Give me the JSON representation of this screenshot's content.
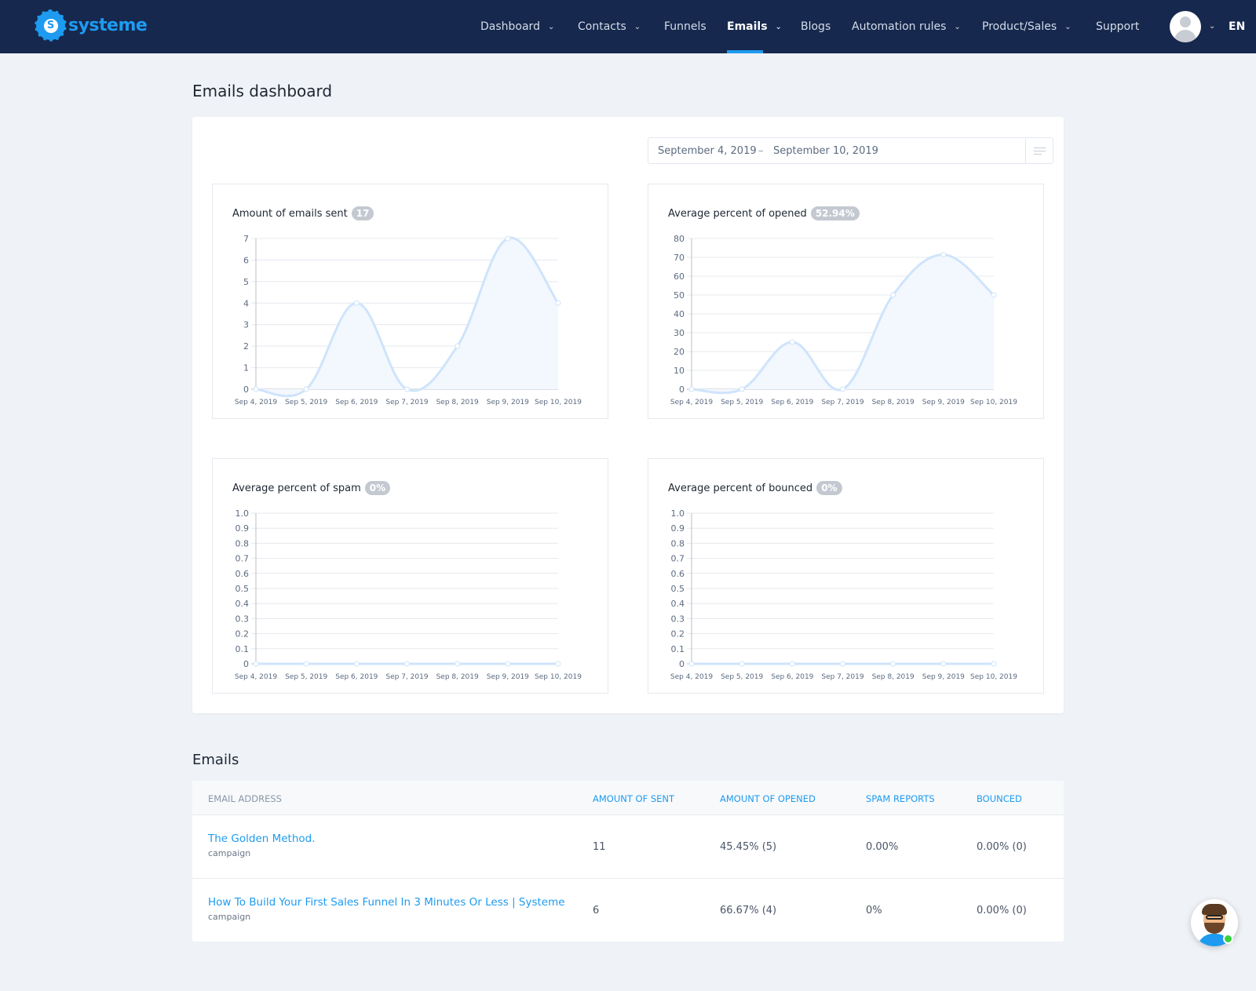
{
  "brand": {
    "name": "systeme",
    "glyph": "S",
    "accent": "#1e9bf0",
    "navbar_bg": "#16284d"
  },
  "nav": {
    "items": [
      {
        "label": "Dashboard",
        "has_dropdown": true
      },
      {
        "label": "Contacts",
        "has_dropdown": true
      },
      {
        "label": "Funnels",
        "has_dropdown": false
      },
      {
        "label": "Emails",
        "has_dropdown": true,
        "active": true
      },
      {
        "label": "Blogs",
        "has_dropdown": false
      },
      {
        "label": "Automation rules",
        "has_dropdown": true
      },
      {
        "label": "Product/Sales",
        "has_dropdown": true
      },
      {
        "label": "Support",
        "has_dropdown": false
      }
    ],
    "language": "EN",
    "avatar_icon": "user-avatar-icon"
  },
  "page": {
    "title": "Emails dashboard"
  },
  "date_range": {
    "start": "September 4, 2019",
    "separator": "–",
    "end": "September 10, 2019",
    "menu_icon": "filter-lines-icon"
  },
  "charts": {
    "sent": {
      "title": "Amount of emails sent",
      "badge": "17"
    },
    "opened": {
      "title": "Average percent of opened",
      "badge": "52.94%"
    },
    "spam": {
      "title": "Average percent of spam",
      "badge": "0%"
    },
    "bounced": {
      "title": "Average percent of bounced",
      "badge": "0%"
    }
  },
  "chart_data": [
    {
      "type": "area",
      "title": "Amount of emails sent",
      "categories": [
        "Sep 4, 2019",
        "Sep 5, 2019",
        "Sep 6, 2019",
        "Sep 7, 2019",
        "Sep 8, 2019",
        "Sep 9, 2019",
        "Sep 10, 2019"
      ],
      "values": [
        0,
        0,
        4,
        0,
        2,
        7,
        4
      ],
      "yticks": [
        "0",
        "1",
        "2",
        "3",
        "4",
        "5",
        "6",
        "7"
      ],
      "ylim": [
        0,
        7
      ],
      "grid": true
    },
    {
      "type": "area",
      "title": "Average percent of opened",
      "categories": [
        "Sep 4, 2019",
        "Sep 5, 2019",
        "Sep 6, 2019",
        "Sep 7, 2019",
        "Sep 8, 2019",
        "Sep 9, 2019",
        "Sep 10, 2019"
      ],
      "values": [
        0,
        0,
        25,
        0,
        50,
        71.43,
        50
      ],
      "yticks": [
        "0",
        "10",
        "20",
        "30",
        "40",
        "50",
        "60",
        "70",
        "80"
      ],
      "ylim": [
        0,
        80
      ],
      "grid": true
    },
    {
      "type": "area",
      "title": "Average percent of spam",
      "categories": [
        "Sep 4, 2019",
        "Sep 5, 2019",
        "Sep 6, 2019",
        "Sep 7, 2019",
        "Sep 8, 2019",
        "Sep 9, 2019",
        "Sep 10, 2019"
      ],
      "values": [
        0,
        0,
        0,
        0,
        0,
        0,
        0
      ],
      "yticks": [
        "0",
        "0.1",
        "0.2",
        "0.3",
        "0.4",
        "0.5",
        "0.6",
        "0.7",
        "0.8",
        "0.9",
        "1.0"
      ],
      "ylim": [
        0,
        1
      ],
      "grid": true
    },
    {
      "type": "area",
      "title": "Average percent of bounced",
      "categories": [
        "Sep 4, 2019",
        "Sep 5, 2019",
        "Sep 6, 2019",
        "Sep 7, 2019",
        "Sep 8, 2019",
        "Sep 9, 2019",
        "Sep 10, 2019"
      ],
      "values": [
        0,
        0,
        0,
        0,
        0,
        0,
        0
      ],
      "yticks": [
        "0",
        "0.1",
        "0.2",
        "0.3",
        "0.4",
        "0.5",
        "0.6",
        "0.7",
        "0.8",
        "0.9",
        "1.0"
      ],
      "ylim": [
        0,
        1
      ],
      "grid": true
    }
  ],
  "emails_table": {
    "title": "Emails",
    "columns": [
      "EMAIL ADDRESS",
      "AMOUNT OF SENT",
      "AMOUNT OF OPENED",
      "SPAM REPORTS",
      "BOUNCED"
    ],
    "rows": [
      {
        "name": "The Golden Method.",
        "type": "campaign",
        "sent": "11",
        "opened": "45.45% (5)",
        "spam": "0.00%",
        "bounced": "0.00% (0)"
      },
      {
        "name": "How To Build Your First Sales Funnel In 3 Minutes Or Less | Systeme",
        "type": "campaign",
        "sent": "6",
        "opened": "66.67% (4)",
        "spam": "0%",
        "bounced": "0.00% (0)"
      }
    ]
  },
  "chat_widget": {
    "icon": "support-agent-avatar-icon",
    "status_color": "#37d03f"
  }
}
